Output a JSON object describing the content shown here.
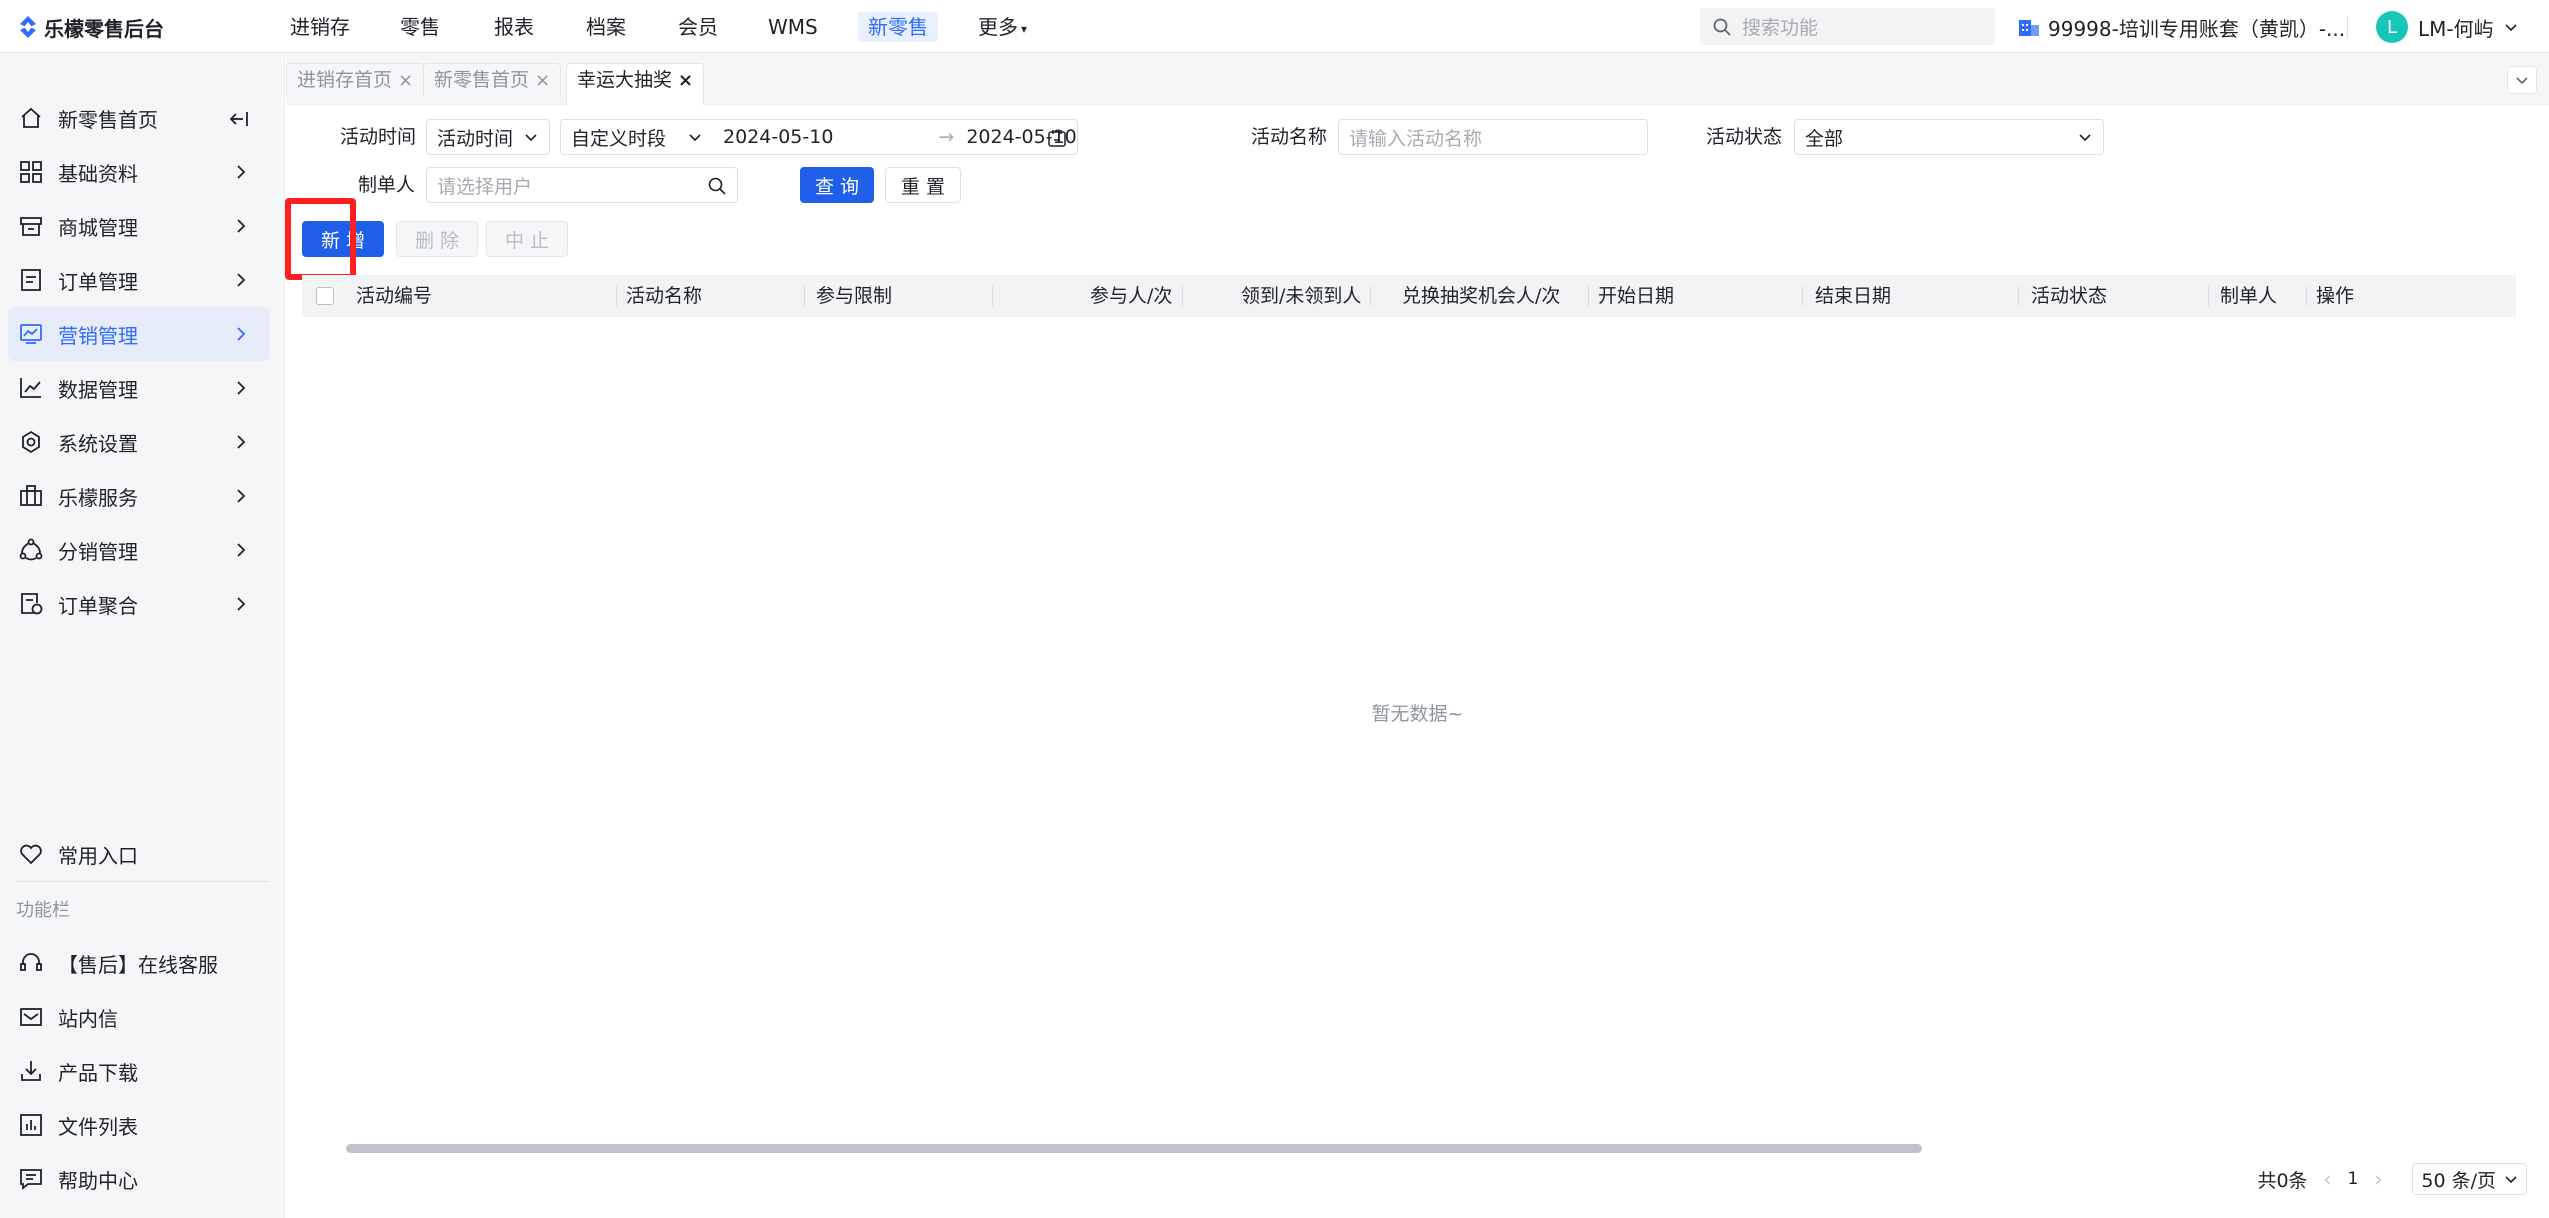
{
  "app": {
    "title": "乐檬零售后台"
  },
  "topnav": [
    "进销存",
    "零售",
    "报表",
    "档案",
    "会员",
    "WMS",
    "新零售",
    "更多"
  ],
  "search": {
    "placeholder": "搜索功能"
  },
  "account": {
    "label": "99998-培训专用账套（黄凯）-..."
  },
  "user": {
    "initial": "L",
    "name": "LM-何屿"
  },
  "sidebar": {
    "items": [
      {
        "label": "新零售首页"
      },
      {
        "label": "基础资料"
      },
      {
        "label": "商城管理"
      },
      {
        "label": "订单管理"
      },
      {
        "label": "营销管理"
      },
      {
        "label": "数据管理"
      },
      {
        "label": "系统设置"
      },
      {
        "label": "乐檬服务"
      },
      {
        "label": "分销管理"
      },
      {
        "label": "订单聚合"
      }
    ],
    "favorites": "常用入口",
    "section_title": "功能栏",
    "tools": [
      {
        "label": "【售后】在线客服"
      },
      {
        "label": "站内信"
      },
      {
        "label": "产品下载"
      },
      {
        "label": "文件列表"
      },
      {
        "label": "帮助中心"
      }
    ]
  },
  "tabs": [
    {
      "label": "进销存首页"
    },
    {
      "label": "新零售首页"
    },
    {
      "label": "幸运大抽奖"
    }
  ],
  "filters": {
    "time_label": "活动时间",
    "time_type": "活动时间",
    "period": "自定义时段",
    "start_date": "2024-05-10",
    "end_date": "2024-05-10",
    "name_label": "活动名称",
    "name_placeholder": "请输入活动名称",
    "status_label": "活动状态",
    "status_value": "全部",
    "creator_label": "制单人",
    "creator_placeholder": "请选择用户",
    "query": "查 询",
    "reset": "重 置"
  },
  "actions": {
    "add": "新 增",
    "delete": "删 除",
    "stop": "中 止"
  },
  "table": {
    "columns": [
      "活动编号",
      "活动名称",
      "参与限制",
      "参与人/次",
      "领到/未领到人",
      "兑换抽奖机会人/次",
      "开始日期",
      "结束日期",
      "活动状态",
      "制单人",
      "操作"
    ],
    "empty_text": "暂无数据~"
  },
  "pager": {
    "total": "共0条",
    "page": "1",
    "size": "50 条/页"
  }
}
